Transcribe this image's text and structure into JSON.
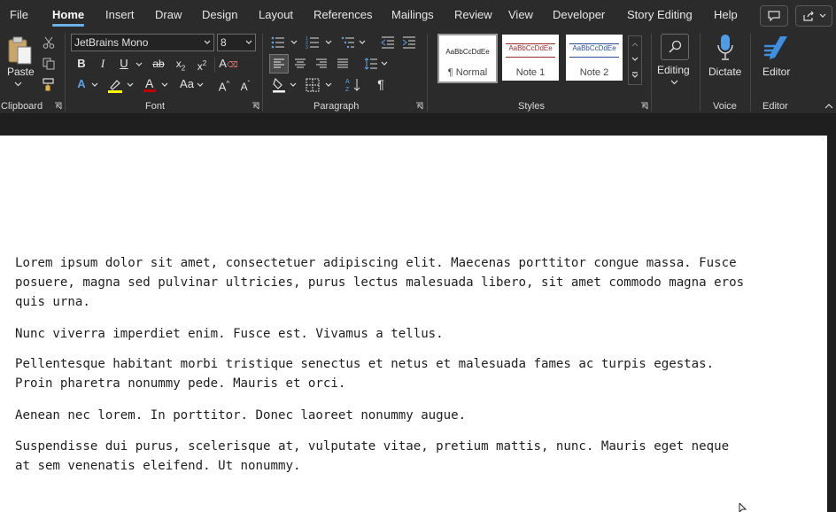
{
  "menu": {
    "file": "File",
    "home": "Home",
    "insert": "Insert",
    "draw": "Draw",
    "design": "Design",
    "layout": "Layout",
    "references": "References",
    "mailings": "Mailings",
    "review": "Review",
    "view": "View",
    "developer": "Developer",
    "story_editing": "Story Editing",
    "help": "Help"
  },
  "ribbon": {
    "clipboard": {
      "paste_label": "Paste",
      "group_label": "Clipboard"
    },
    "font": {
      "font_name": "JetBrains Mono",
      "font_size": "8",
      "group_label": "Font"
    },
    "paragraph": {
      "group_label": "Paragraph"
    },
    "styles": {
      "group_label": "Styles",
      "preview_text": "AaBbCcDdEe",
      "items": [
        {
          "name": "¶ Normal"
        },
        {
          "name": "Note 1"
        },
        {
          "name": "Note 2"
        }
      ]
    },
    "editing": {
      "label": "Editing"
    },
    "voice": {
      "dictate_label": "Dictate",
      "group_label": "Voice"
    },
    "editor": {
      "editor_label": "Editor",
      "group_label": "Editor"
    }
  },
  "document": {
    "paragraphs": [
      "Lorem ipsum dolor sit amet, consectetuer adipiscing elit. Maecenas porttitor congue massa. Fusce\nposuere, magna sed pulvinar ultricies, purus lectus malesuada libero, sit amet commodo magna eros\nquis urna.",
      "Nunc viverra imperdiet enim. Fusce est. Vivamus a tellus.",
      "Pellentesque habitant morbi tristique senectus et netus et malesuada fames ac turpis egestas.\nProin pharetra nonummy pede. Mauris et orci.",
      "Aenean nec lorem. In porttitor. Donec laoreet nonummy augue.",
      "Suspendisse dui purus, scelerisque at, vulputate vitae, pretium mattis, nunc. Mauris eget neque\nat sem venenatis eleifend. Ut nonummy."
    ]
  },
  "colors": {
    "accent": "#6cb0e8",
    "font_color_bar": "#c00000",
    "highlight_bar": "#ffff00"
  }
}
